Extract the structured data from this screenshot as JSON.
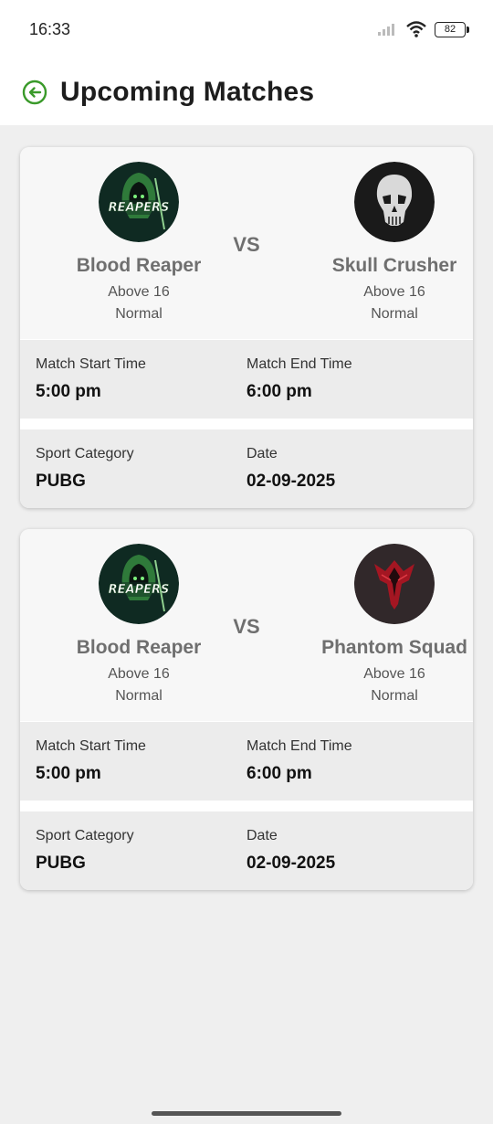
{
  "status_bar": {
    "time": "16:33",
    "battery": "82"
  },
  "header": {
    "title": "Upcoming Matches",
    "back_icon": "back-arrow-circle-icon",
    "accent_color": "#3a9a2a"
  },
  "matches": [
    {
      "team_a": {
        "name": "Blood Reaper",
        "age": "Above 16",
        "level": "Normal",
        "logo": "reapers-logo"
      },
      "vs_label": "VS",
      "team_b": {
        "name": "Skull Crusher",
        "age": "Above 16",
        "level": "Normal",
        "logo": "skull-logo"
      },
      "start_label": "Match Start Time",
      "start_value": "5:00 pm",
      "end_label": "Match End Time",
      "end_value": "6:00 pm",
      "category_label": "Sport Category",
      "category_value": "PUBG",
      "date_label": "Date",
      "date_value": "02-09-2025"
    },
    {
      "team_a": {
        "name": "Blood Reaper",
        "age": "Above 16",
        "level": "Normal",
        "logo": "reapers-logo"
      },
      "vs_label": "VS",
      "team_b": {
        "name": "Phantom Squad",
        "age": "Above 16",
        "level": "Normal",
        "logo": "phantom-logo"
      },
      "start_label": "Match Start Time",
      "start_value": "5:00 pm",
      "end_label": "Match End Time",
      "end_value": "6:00 pm",
      "category_label": "Sport Category",
      "category_value": "PUBG",
      "date_label": "Date",
      "date_value": "02-09-2025"
    }
  ]
}
